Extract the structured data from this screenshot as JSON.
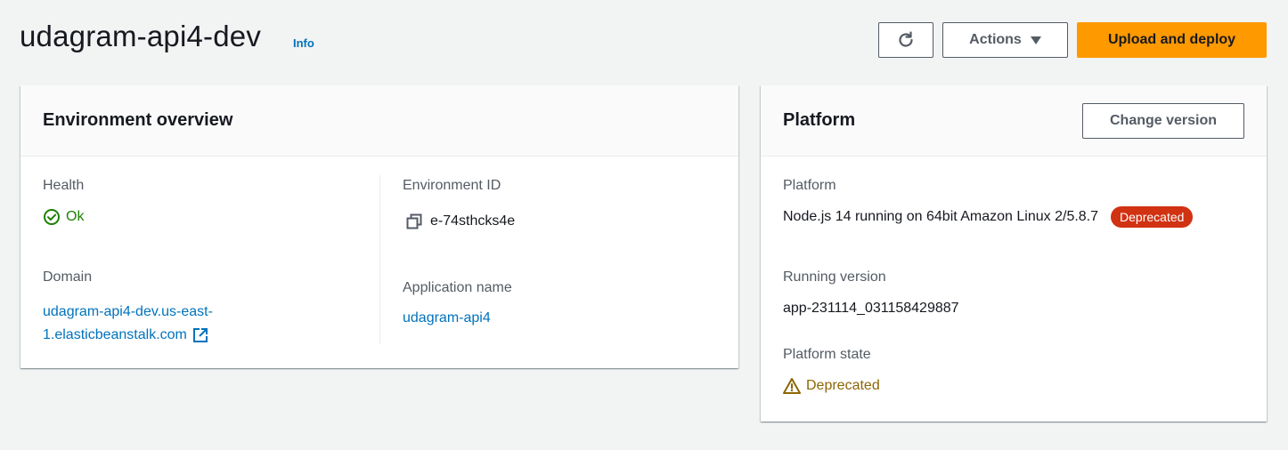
{
  "header": {
    "title": "udagram-api4-dev",
    "info_label": "Info",
    "actions_label": "Actions",
    "upload_label": "Upload and deploy"
  },
  "overview": {
    "title": "Environment overview",
    "health_label": "Health",
    "health_value": "Ok",
    "domain_label": "Domain",
    "domain_line1": "udagram-api4-dev.us-east-",
    "domain_line2": "1.elasticbeanstalk.com",
    "env_id_label": "Environment ID",
    "env_id_value": "e-74sthcks4e",
    "app_name_label": "Application name",
    "app_name_value": "udagram-api4"
  },
  "platform": {
    "title": "Platform",
    "change_version_label": "Change version",
    "platform_label": "Platform",
    "platform_value": "Node.js 14 running on 64bit Amazon Linux 2/5.8.7",
    "platform_badge": "Deprecated",
    "running_version_label": "Running version",
    "running_version_value": "app-231114_031158429887",
    "state_label": "Platform state",
    "state_value": "Deprecated"
  },
  "colors": {
    "primary_button": "#ff9900",
    "link": "#0073bb",
    "success": "#1d8102",
    "warning": "#8d6605",
    "deprecated_badge": "#d13212"
  },
  "icons": {
    "refresh": "refresh-icon",
    "caret": "caret-down-icon",
    "ok": "status-ok-icon",
    "external": "external-link-icon",
    "copy": "copy-icon",
    "warning": "warning-icon"
  }
}
